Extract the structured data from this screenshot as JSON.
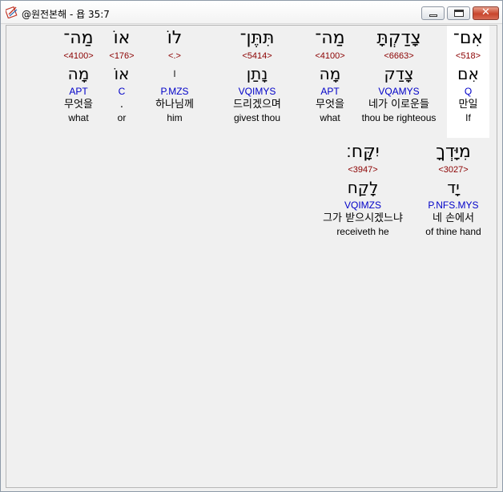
{
  "window": {
    "title": "@원전본해 - 욥 35:7",
    "minimize_label": "",
    "maximize_label": "",
    "close_label": "✕"
  },
  "words": [
    {
      "hebrew": "אִם־",
      "strong": "<518>",
      "root": "אִם",
      "morph": "Q",
      "korean": "만일",
      "english": "If",
      "selected": true
    },
    {
      "hebrew": "צָדַקְתָּ",
      "strong": "<6663>",
      "root": "צָדַק",
      "morph": "VQAMYS",
      "korean": "네가 이로운들",
      "english": "thou be righteous",
      "selected": false
    },
    {
      "hebrew": "מַה־",
      "strong": "<4100>",
      "root": "מָה",
      "morph": "APT",
      "korean": "무엇을",
      "english": "what",
      "selected": false
    },
    {
      "hebrew": "תִּתֶּן־",
      "strong": "<5414>",
      "root": "נָתַן",
      "morph": "VQIMYS",
      "korean": "드리겠으며",
      "english": "givest thou",
      "selected": false
    },
    {
      "hebrew": "לוֹ",
      "strong": "<.>",
      "root": "׀",
      "morph": "P.MZS",
      "korean": "하나님께",
      "english": "him",
      "selected": false
    },
    {
      "hebrew": "אוֹ",
      "strong": "<176>",
      "root": "אוֹ",
      "morph": "C",
      "korean": ".",
      "english": "or",
      "selected": false
    },
    {
      "hebrew": "מַה־",
      "strong": "<4100>",
      "root": "מָה",
      "morph": "APT",
      "korean": "무엇을",
      "english": "what",
      "selected": false
    },
    {
      "hebrew": "מִיָּדְךָ",
      "strong": "<3027>",
      "root": "יָד",
      "morph": "P.NFS.MYS",
      "korean": "네 손에서",
      "english": "of thine hand",
      "selected": false
    },
    {
      "hebrew": "יִקָּח׃",
      "strong": "<3947>",
      "root": "לָקַח",
      "morph": "VQIMZS",
      "korean": "그가 받으시겠느냐",
      "english": "receiveth he",
      "selected": false
    }
  ]
}
